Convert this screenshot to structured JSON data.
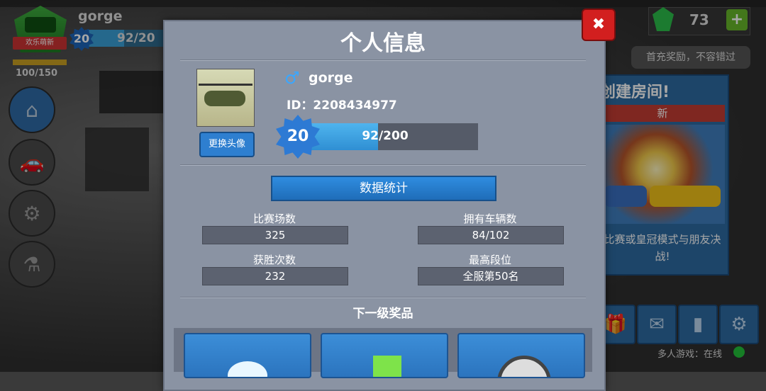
{
  "hud": {
    "player_name": "gorge",
    "rank_ribbon": "欢乐萌新",
    "level": "20",
    "xp_text": "92/20",
    "energy_text": "100/150",
    "gems": "73",
    "plus": "+",
    "promo": "首充奖励，不容错过"
  },
  "nav": [
    "home-icon",
    "car-icon",
    "claw-icon",
    "flask-icon"
  ],
  "side_card": {
    "title": "创建房间!",
    "badge": "新",
    "description": "比赛或皇冠模式与朋友决战!"
  },
  "bottom_icons": [
    "gift-icon",
    "mail-icon",
    "leaderboard-icon",
    "gear-icon"
  ],
  "online_status": "多人游戏：在线",
  "profile": {
    "title": "个人信息",
    "close": "✖",
    "change_avatar": "更换头像",
    "name": "gorge",
    "id_text": "ID：2208434977",
    "level": "20",
    "xp_text": "92/200",
    "xp_fraction": 0.46,
    "stats_header": "数据统计",
    "stats": [
      {
        "label": "比赛场数",
        "value": "325"
      },
      {
        "label": "拥有车辆数",
        "value": "84/102"
      },
      {
        "label": "获胜次数",
        "value": "232"
      },
      {
        "label": "最高段位",
        "value": "全服第50名"
      }
    ],
    "next_reward_title": "下一级奖品"
  },
  "colors": {
    "accent": "#2f8de0",
    "close": "#d21f1f",
    "gem": "#2cbd4a",
    "online": "#23c23a"
  }
}
